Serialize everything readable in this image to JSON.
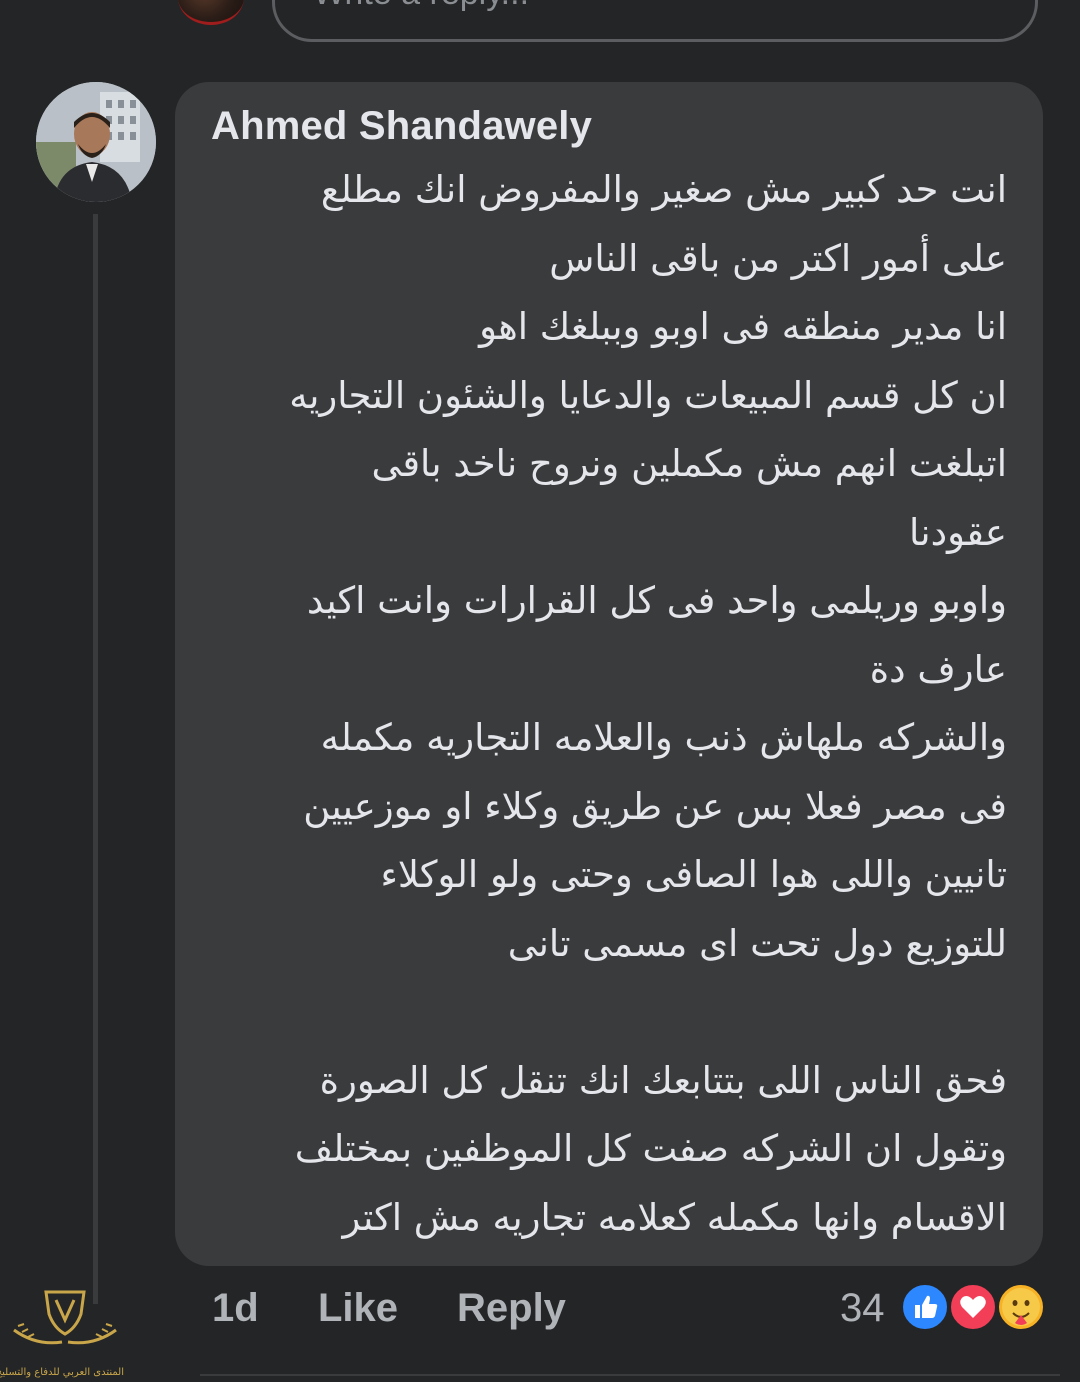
{
  "reply_bar": {
    "placeholder": "Write a reply..."
  },
  "comment": {
    "author": "Ahmed Shandawely",
    "lines": [
      "انت حد كبير مش صغير والمفروض انك مطلع",
      "على أمور اكتر من باقى الناس",
      "انا مدير منطقه فى اوبو وببلغك اهو",
      "ان كل قسم المبيعات والدعايا والشئون التجاريه",
      "اتبلغت انهم مش مكملين ونروح ناخد باقى",
      "عقودنا",
      "واوبو وريلمى واحد فى كل القرارات وانت اكيد",
      "عارف دة",
      "والشركه ملهاش ذنب والعلامه التجاريه مكمله",
      "فى مصر فعلا بس عن طريق وكلاء او موزعيين",
      "تانيين واللى هوا الصافى وحتى ولو الوكلاء",
      "للتوزيع دول تحت اى مسمى تانى",
      "",
      "فحق الناس اللى بتتابعك انك تنقل كل الصورة",
      "وتقول ان الشركه صفت كل الموظفين بمختلف",
      "الاقسام وانها مكمله كعلامه تجاريه مش اكتر"
    ]
  },
  "actions": {
    "time": "1d",
    "like": "Like",
    "reply": "Reply"
  },
  "reactions": {
    "count": "34",
    "types": [
      "like-icon",
      "love-icon",
      "care-icon"
    ],
    "colors": {
      "like": "#2d88ff",
      "love": "#f33e58",
      "care": "#f7b125"
    }
  },
  "watermark": {
    "text": "المنتدى العربي للدفاع والتسليح"
  }
}
